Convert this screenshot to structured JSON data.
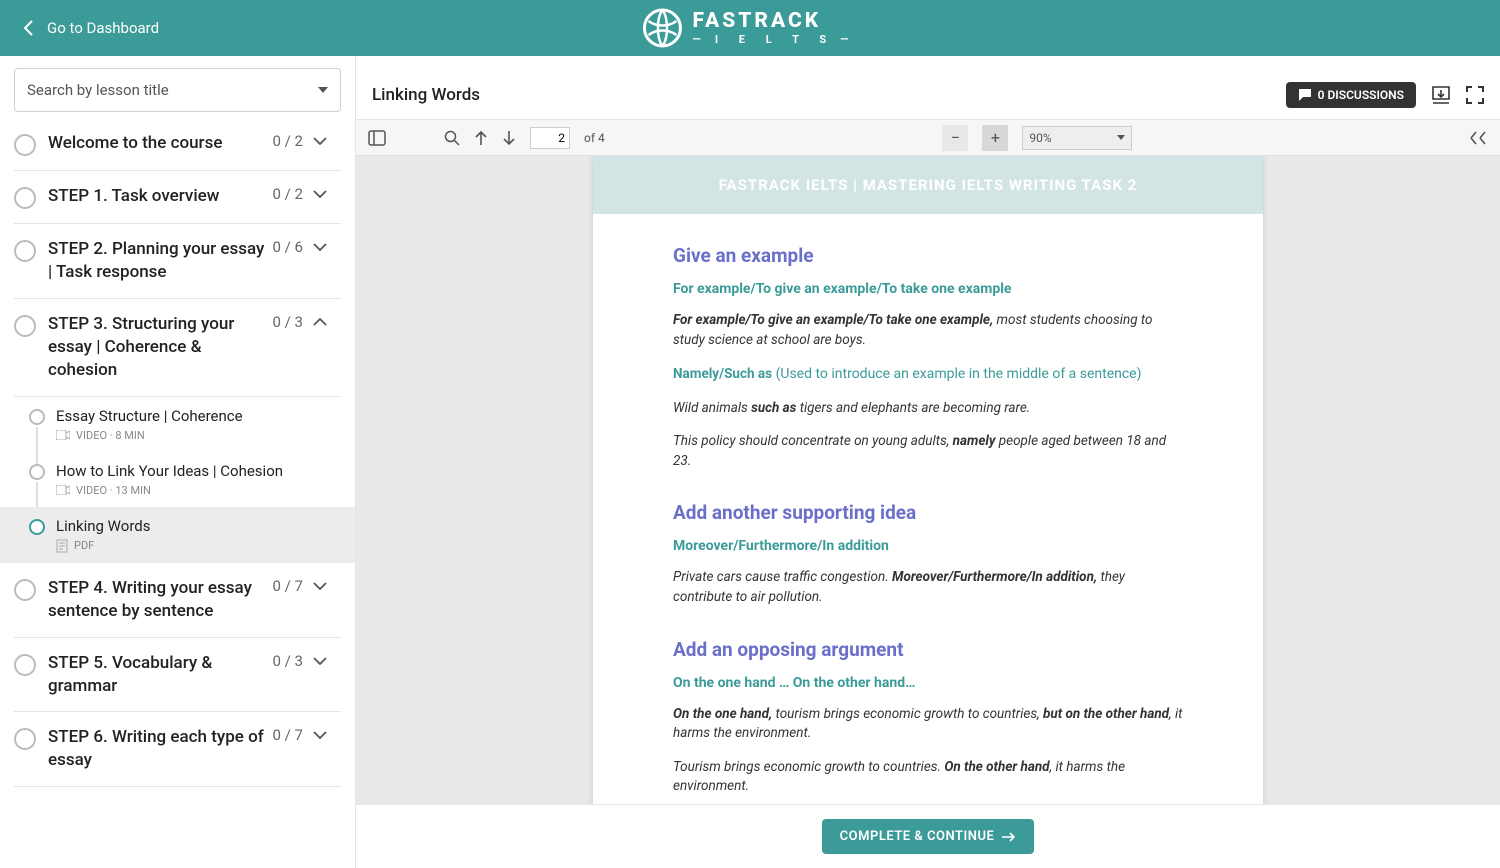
{
  "header": {
    "back_label": "Go to Dashboard",
    "brand_main": "FASTRACK",
    "brand_sub": "I E L T S"
  },
  "sidebar": {
    "search_placeholder": "Search by lesson title",
    "modules": [
      {
        "title": "Welcome to the course",
        "count": "0 / 2",
        "expanded": false
      },
      {
        "title": "STEP 1. Task overview",
        "count": "0 / 2",
        "expanded": false
      },
      {
        "title": "STEP 2. Planning your essay | Task response",
        "count": "0 / 6",
        "expanded": false
      },
      {
        "title": "STEP 3. Structuring your essay | Coherence & cohesion",
        "count": "0 / 3",
        "expanded": true,
        "lessons": [
          {
            "title": "Essay Structure | Coherence",
            "meta": "VIDEO · 8 MIN",
            "type": "video"
          },
          {
            "title": "How to Link Your Ideas | Cohesion",
            "meta": "VIDEO · 13 MIN",
            "type": "video"
          },
          {
            "title": "Linking Words",
            "meta": "PDF",
            "type": "pdf",
            "active": true
          }
        ]
      },
      {
        "title": "STEP 4. Writing your essay sentence by sentence",
        "count": "0 / 7",
        "expanded": false
      },
      {
        "title": "STEP 5. Vocabulary & grammar",
        "count": "0 / 3",
        "expanded": false
      },
      {
        "title": "STEP 6. Writing each type of essay",
        "count": "0 / 7",
        "expanded": false
      }
    ]
  },
  "content": {
    "title": "Linking Words",
    "discussions": "0 DISCUSSIONS",
    "pdf_toolbar": {
      "page": "2",
      "page_total": "of 4",
      "zoom": "90%"
    },
    "complete": "COMPLETE & CONTINUE"
  },
  "document": {
    "band": "FASTRACK IELTS | MASTERING IELTS WRITING TASK 2",
    "sections": [
      {
        "heading": "Give an example",
        "sub": "For example/To give an example/To take one example",
        "paras": [
          {
            "pre_b": "For example/To give an example/To take one example,",
            "rest": " most students choosing to study science at school are boys."
          },
          {
            "sub_inline": "Namely/Such as",
            "note": " (Used to introduce an example in the middle of a sentence)"
          },
          {
            "pre": "Wild animals ",
            "mid_b": "such as",
            "rest": " tigers and elephants are becoming rare."
          },
          {
            "pre": "This policy should concentrate on young adults, ",
            "mid_b": "namely",
            "rest": " people aged between 18 and 23."
          }
        ]
      },
      {
        "heading": "Add another supporting idea",
        "sub": "Moreover/Furthermore/In addition",
        "paras": [
          {
            "pre": "Private cars cause traffic congestion. ",
            "mid_b": "Moreover/Furthermore/In addition,",
            "rest": " they contribute to air pollution."
          }
        ]
      },
      {
        "heading": "Add an opposing argument",
        "sub": "On the one hand … On the other hand…",
        "paras": [
          {
            "pre_b": "On the one hand,",
            "mid": " tourism brings economic growth to countries, ",
            "mid_b2": "but on the other hand",
            "rest": ", it harms the environment."
          },
          {
            "pre": "Tourism brings economic growth to countries. ",
            "mid_b": "On the other hand",
            "rest": ", it harms the environment."
          }
        ]
      }
    ]
  }
}
